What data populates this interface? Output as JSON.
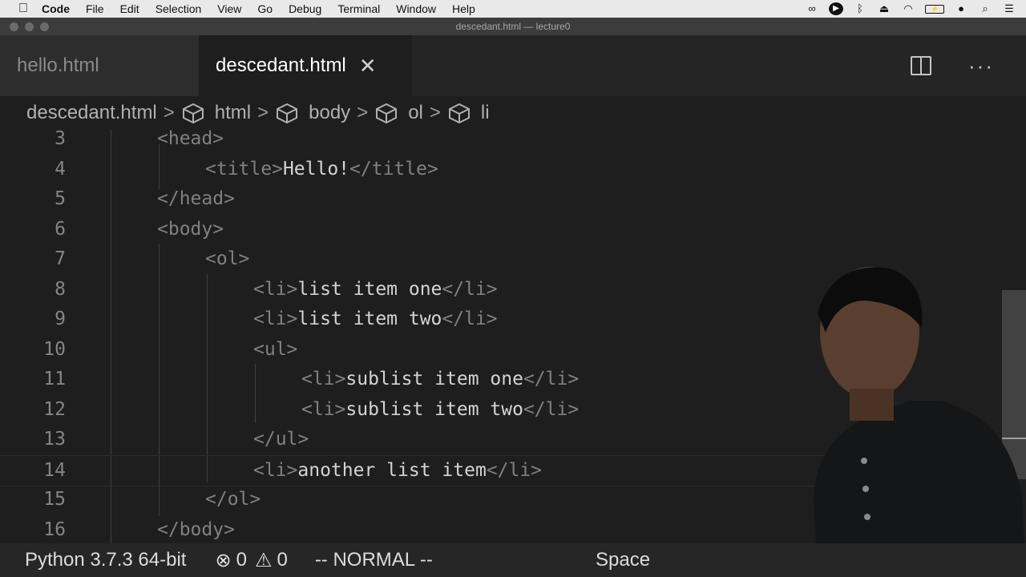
{
  "menubar": {
    "apple_icon": "apple-logo-icon",
    "items": [
      "Code",
      "File",
      "Edit",
      "Selection",
      "View",
      "Go",
      "Debug",
      "Terminal",
      "Window",
      "Help"
    ],
    "tray_icons": [
      "glasses-icon",
      "play-circle-icon",
      "bluetooth-icon",
      "eject-icon",
      "wifi-icon",
      "battery-icon",
      "user-icon",
      "search-icon",
      "list-icon"
    ]
  },
  "window": {
    "title": "descedant.html — lecture0"
  },
  "tabs": [
    {
      "label": "hello.html",
      "active": false
    },
    {
      "label": "descedant.html",
      "active": true,
      "close": "✕"
    }
  ],
  "breadcrumb": {
    "file": "descedant.html",
    "items": [
      "html",
      "body",
      "ol",
      "li"
    ]
  },
  "editor": {
    "lines": [
      {
        "num": "3",
        "indent": 2,
        "parts": [
          [
            "tag",
            "<head>"
          ]
        ]
      },
      {
        "num": "4",
        "indent": 3,
        "parts": [
          [
            "tag",
            "<title>"
          ],
          [
            "txt",
            "Hello!"
          ],
          [
            "tag",
            "</title>"
          ]
        ]
      },
      {
        "num": "5",
        "indent": 2,
        "parts": [
          [
            "tag",
            "</head>"
          ]
        ]
      },
      {
        "num": "6",
        "indent": 2,
        "parts": [
          [
            "tag",
            "<body>"
          ]
        ]
      },
      {
        "num": "7",
        "indent": 3,
        "parts": [
          [
            "tag",
            "<ol>"
          ]
        ]
      },
      {
        "num": "8",
        "indent": 4,
        "parts": [
          [
            "tag",
            "<li>"
          ],
          [
            "txt",
            "list item one"
          ],
          [
            "tag",
            "</li>"
          ]
        ]
      },
      {
        "num": "9",
        "indent": 4,
        "parts": [
          [
            "tag",
            "<li>"
          ],
          [
            "txt",
            "list item two"
          ],
          [
            "tag",
            "</li>"
          ]
        ]
      },
      {
        "num": "10",
        "indent": 4,
        "parts": [
          [
            "tag",
            "<ul>"
          ]
        ]
      },
      {
        "num": "11",
        "indent": 5,
        "parts": [
          [
            "tag",
            "<li>"
          ],
          [
            "txt",
            "sublist item one"
          ],
          [
            "tag",
            "</li>"
          ]
        ]
      },
      {
        "num": "12",
        "indent": 5,
        "parts": [
          [
            "tag",
            "<li>"
          ],
          [
            "txt",
            "sublist item two"
          ],
          [
            "tag",
            "</li>"
          ]
        ]
      },
      {
        "num": "13",
        "indent": 4,
        "parts": [
          [
            "tag",
            "</ul>"
          ]
        ]
      },
      {
        "num": "14",
        "indent": 4,
        "parts": [
          [
            "tag",
            "<li>"
          ],
          [
            "txt",
            "another list item"
          ],
          [
            "tag",
            "</li>"
          ]
        ],
        "current": true
      },
      {
        "num": "15",
        "indent": 3,
        "parts": [
          [
            "tag",
            "</ol>"
          ]
        ]
      },
      {
        "num": "16",
        "indent": 2,
        "parts": [
          [
            "tag",
            "</body>"
          ]
        ]
      }
    ]
  },
  "statusbar": {
    "python": "Python 3.7.3 64-bit",
    "errors": "0",
    "warnings": "0",
    "mode": "-- NORMAL --",
    "spaces": "Space"
  },
  "colors": {
    "editor_bg": "#1e1e1e",
    "tag": "#808080",
    "text": "#d4d4d4",
    "line_number": "#858585"
  }
}
